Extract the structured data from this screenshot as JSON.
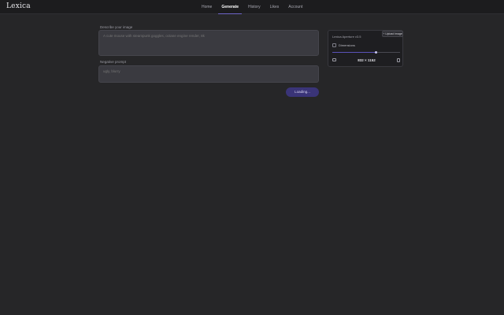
{
  "app": {
    "logo": "Lexica"
  },
  "nav": {
    "items": [
      {
        "label": "Home",
        "active": false
      },
      {
        "label": "Generate",
        "active": true
      },
      {
        "label": "History",
        "active": false
      },
      {
        "label": "Likes",
        "active": false
      },
      {
        "label": "Account",
        "active": false
      }
    ]
  },
  "prompt": {
    "label": "Describe your image",
    "placeholder": "A cute mouse with steampunk goggles, octane engine render, 8k"
  },
  "negative_prompt": {
    "label": "Negative prompt",
    "placeholder": "ugly, blurry"
  },
  "generate_button": {
    "label": "Loading..."
  },
  "settings": {
    "upload_label": "+ Upload image",
    "model_name": "Lexica Aperture v3.5",
    "dimensions_label": "Dimensions",
    "aspect_value": "832 × 1152",
    "slider_fraction": 0.65,
    "accent_color": "#6e64c8"
  }
}
